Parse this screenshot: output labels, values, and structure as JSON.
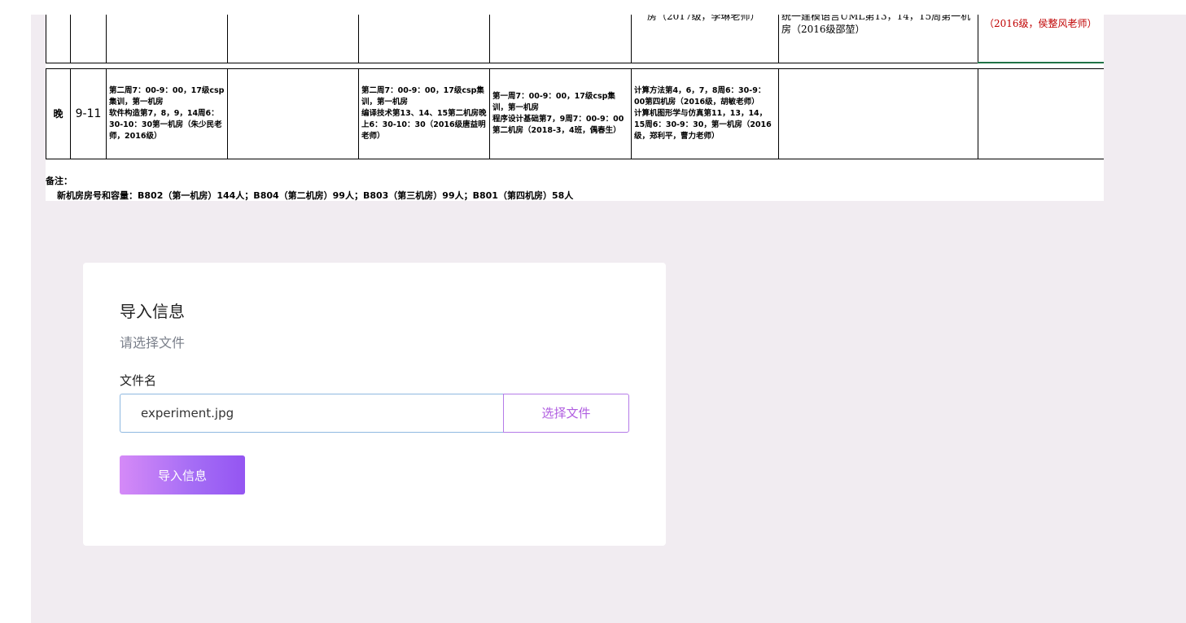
{
  "schedule": {
    "top_row": {
      "col6": "房（2017级，李琳老师）",
      "col7": "统一建模语言UML第13，14，15周第一机房（2016级邵堃）",
      "col8": "（2016级，侯整风老师）"
    },
    "evening_row": {
      "label": "晚",
      "period": "9-11",
      "mon": "第二周7：00-9：00，17级csp集训，第一机房\n软件构造第7，8，9，14周6：30-10：30第一机房（朱少民老师，2016级）",
      "tue": "",
      "wed": "第二周7：00-9：00，17级csp集训，第一机房\n编译技术第13、14、15第二机房晚上6：30-10：30（2016级唐益明老师）",
      "thu": "第一周7：00-9：00，17级csp集训，第一机房\n程序设计基础第7，9周7：00-9：00第二机房（2018-3，4班，偶春生）",
      "fri": "计算方法第4，6，7，8周6：30-9：00第四机房（2016级，胡敏老师）\n计算机图形学与仿真第11，13，14，15周6：30-9：30，第一机房（2016级，郑利平，曹力老师）",
      "sat": "",
      "sun": ""
    },
    "remarks_title": "备注：",
    "remarks_detail": "新机房房号和容量：B802（第一机房）144人；B804（第二机房）99人；B803（第三机房）99人；B801（第四机房）58人"
  },
  "import_card": {
    "title": "导入信息",
    "subtitle": "请选择文件",
    "file_label": "文件名",
    "file_value": "experiment.jpg",
    "choose_button": "选择文件",
    "submit_button": "导入信息"
  }
}
